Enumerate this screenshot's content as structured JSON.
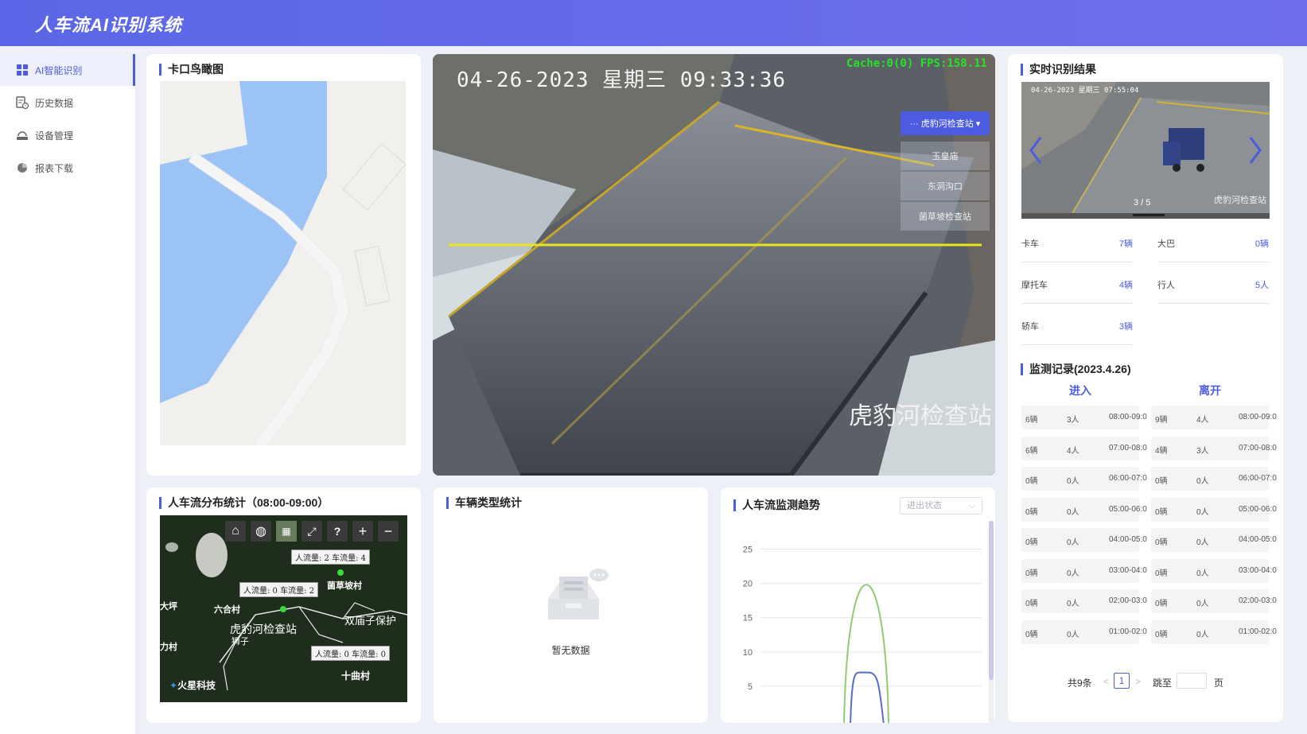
{
  "app_title": "人车流AI识别系统",
  "sidebar": {
    "items": [
      {
        "label": "AI智能识别",
        "icon": "grid-icon",
        "active": true
      },
      {
        "label": "历史数据",
        "icon": "document-clock-icon",
        "active": false
      },
      {
        "label": "设备管理",
        "icon": "device-icon",
        "active": false
      },
      {
        "label": "报表下载",
        "icon": "pie-chart-icon",
        "active": false
      }
    ]
  },
  "map_card": {
    "title": "卡口鸟瞰图"
  },
  "video": {
    "timestamp": "04-26-2023 星期三 09:33:36",
    "cache_text": "Cache:0(0) FPS:158.11",
    "station_overlay": "虎豹河检查站",
    "station_dropdown": {
      "selected": "··· 虎豹河检查站 ▾",
      "options": [
        "玉皇庙",
        "东洞沟口",
        "菌草坡检查站"
      ]
    }
  },
  "realtime": {
    "title": "实时识别结果",
    "image_timestamp": "04-26-2023 星期三 07:55:04",
    "image_station": "虎豹河检查站",
    "carousel_counter": "3 / 5",
    "stats": [
      {
        "label": "卡车",
        "value": "7辆"
      },
      {
        "label": "大巴",
        "value": "0辆"
      },
      {
        "label": "摩托车",
        "value": "4辆"
      },
      {
        "label": "行人",
        "value": "5人"
      },
      {
        "label": "轿车",
        "value": "3辆"
      }
    ]
  },
  "records": {
    "title": "监测记录(2023.4.26)",
    "in_label": "进入",
    "out_label": "离开",
    "in_rows": [
      [
        "6辆",
        "3人",
        "08:00-09:0"
      ],
      [
        "6辆",
        "4人",
        "07:00-08:0"
      ],
      [
        "0辆",
        "0人",
        "06:00-07:0"
      ],
      [
        "0辆",
        "0人",
        "05:00-06:0"
      ],
      [
        "0辆",
        "0人",
        "04:00-05:0"
      ],
      [
        "0辆",
        "0人",
        "03:00-04:0"
      ],
      [
        "0辆",
        "0人",
        "02:00-03:0"
      ],
      [
        "0辆",
        "0人",
        "01:00-02:0"
      ]
    ],
    "out_rows": [
      [
        "9辆",
        "4人",
        "08:00-09:0"
      ],
      [
        "4辆",
        "3人",
        "07:00-08:0"
      ],
      [
        "0辆",
        "0人",
        "06:00-07:0"
      ],
      [
        "0辆",
        "0人",
        "05:00-06:0"
      ],
      [
        "0辆",
        "0人",
        "04:00-05:0"
      ],
      [
        "0辆",
        "0人",
        "03:00-04:0"
      ],
      [
        "0辆",
        "0人",
        "02:00-03:0"
      ],
      [
        "0辆",
        "0人",
        "01:00-02:0"
      ]
    ],
    "pager": {
      "total": "共9条",
      "prev": "<",
      "page": "1",
      "next": ">",
      "jump_label": "跳至",
      "page_unit": "页"
    }
  },
  "distribution": {
    "title": "人车流分布统计（08:00-09:00）",
    "labels": [
      "人流量: 2 车流量: 4",
      "人流量: 0 车流量: 2",
      "人流量: 0 车流量: 0"
    ],
    "places": [
      "菌草坡村",
      "六合村",
      "大坪",
      "虎豹河检查站",
      "双庙子保护",
      "十曲村",
      "力村",
      "狮子"
    ],
    "brand": "火星科技"
  },
  "vehicle_type": {
    "title": "车辆类型统计",
    "empty_text": "暂无数据"
  },
  "trend": {
    "title": "人车流监测趋势",
    "select_placeholder": "进出状态"
  },
  "chart_data": {
    "type": "line",
    "title": "人车流监测趋势",
    "y_ticks": [
      5,
      10,
      15,
      20,
      25
    ],
    "ylim": [
      0,
      25
    ],
    "series": [
      {
        "color": "#91cc75",
        "peak": 22
      },
      {
        "color": "#5470c6",
        "peak": 7
      }
    ],
    "grid": true
  },
  "colors": {
    "accent": "#4b5ce0",
    "header": "#5b67e8"
  }
}
